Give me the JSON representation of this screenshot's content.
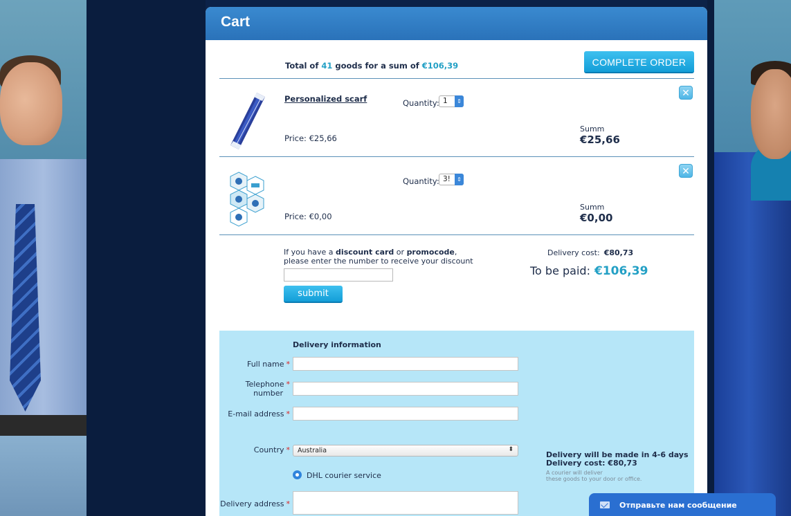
{
  "cart": {
    "title": "Cart",
    "summary": {
      "prefix": "Total of",
      "count": "41",
      "middle": "goods for a sum of",
      "sum": "€106,39"
    },
    "complete_order_label": "COMPLETE ORDER",
    "items": [
      {
        "name": "Personalized scarf",
        "quantity_label": "Quantity:",
        "quantity": "1",
        "price": "Price: €25,66",
        "summ_label": "Summ",
        "summ": "€25,66"
      },
      {
        "name": "",
        "quantity_label": "Quantity:",
        "quantity": "3!",
        "price": "Price: €0,00",
        "summ_label": "Summ",
        "summ": "€0,00"
      }
    ],
    "discount": {
      "line1_a": "If you have a ",
      "line1_b": "discount card",
      "line1_c": " or ",
      "line1_d": "promocode",
      "line1_e": ",",
      "line2": "please enter the number to receive your discount",
      "submit_label": "submit"
    },
    "delivery_cost_label": "Delivery cost:",
    "delivery_cost": "€80,73",
    "to_be_paid_label": "To be paid:",
    "to_be_paid": "€106,39"
  },
  "delivery_info": {
    "title": "Delivery information",
    "full_name_label": "Full name",
    "telephone_label_1": "Telephone",
    "telephone_label_2": "number",
    "email_label": "E-mail address",
    "country_label": "Country",
    "country_value": "Australia",
    "service_label": "DHL courier service",
    "address_label": "Delivery address",
    "days_line": "Delivery will be made in 4-6 days",
    "cost_line": "Delivery cost: €80,73",
    "note_line1": "A courier will deliver",
    "note_line2": "these goods to your door or office.",
    "required_mark": "*"
  },
  "chat": {
    "label": "Отправьте нам сообщение"
  },
  "colors": {
    "accent": "#23a0c5",
    "button": "#139ed8",
    "header": "#2a72b9",
    "delivery_bg": "#b6e6f8"
  }
}
